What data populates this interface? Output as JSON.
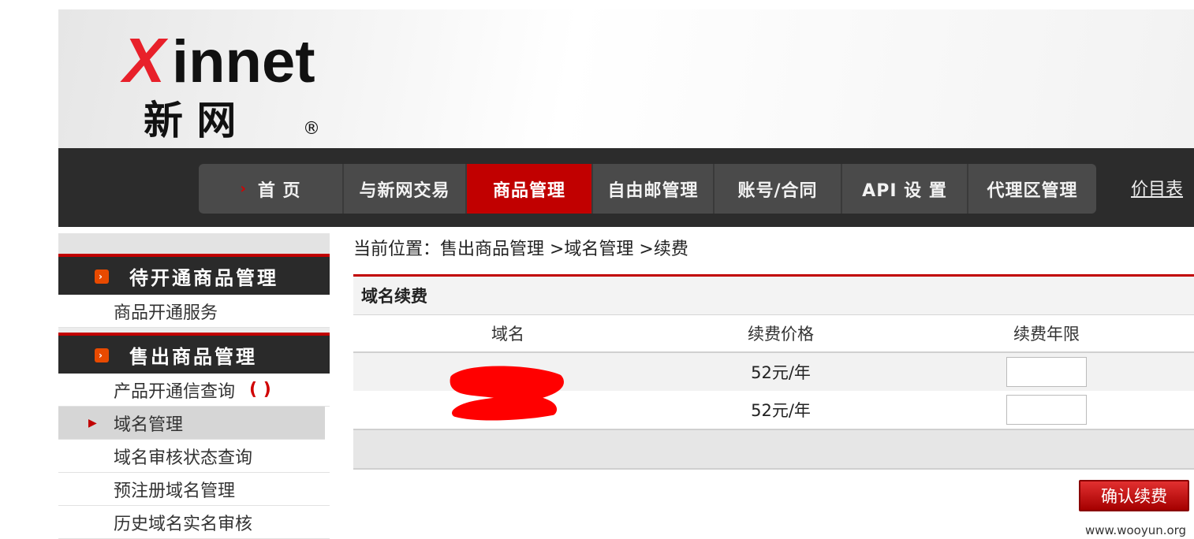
{
  "brand": {
    "logo_latin": "xinnet",
    "logo_cn": "新 网",
    "logo_reg": "®"
  },
  "nav": {
    "items": [
      {
        "label": "首 页"
      },
      {
        "label": "与新网交易"
      },
      {
        "label": "商品管理"
      },
      {
        "label": "自由邮管理"
      },
      {
        "label": "账号/合同"
      },
      {
        "label": "API 设 置"
      },
      {
        "label": "代理区管理"
      }
    ],
    "active_index": 2,
    "price_link": "价目表",
    "colors": {
      "active": "#c10000",
      "bar": "#2c2c2c"
    }
  },
  "sidebar": {
    "section1": {
      "title": "待开通商品管理",
      "items": [
        "商品开通服务"
      ]
    },
    "section2": {
      "title": "售出商品管理",
      "items": [
        "产品开通信查询",
        "域名管理",
        "域名审核状态查询",
        "预注册域名管理",
        "历史域名实名审核"
      ],
      "item0_suffix": "( )",
      "selected_index": 1
    }
  },
  "breadcrumb": "当前位置：售出商品管理 >域名管理 >续费",
  "panel": {
    "title": "域名续费",
    "columns": [
      "域名",
      "续费价格",
      "续费年限"
    ],
    "rows": [
      {
        "domain": "",
        "price": "52元/年"
      },
      {
        "domain": "",
        "price": "52元/年"
      }
    ]
  },
  "confirm_button": "确认续费",
  "watermark": "www.wooyun.org"
}
